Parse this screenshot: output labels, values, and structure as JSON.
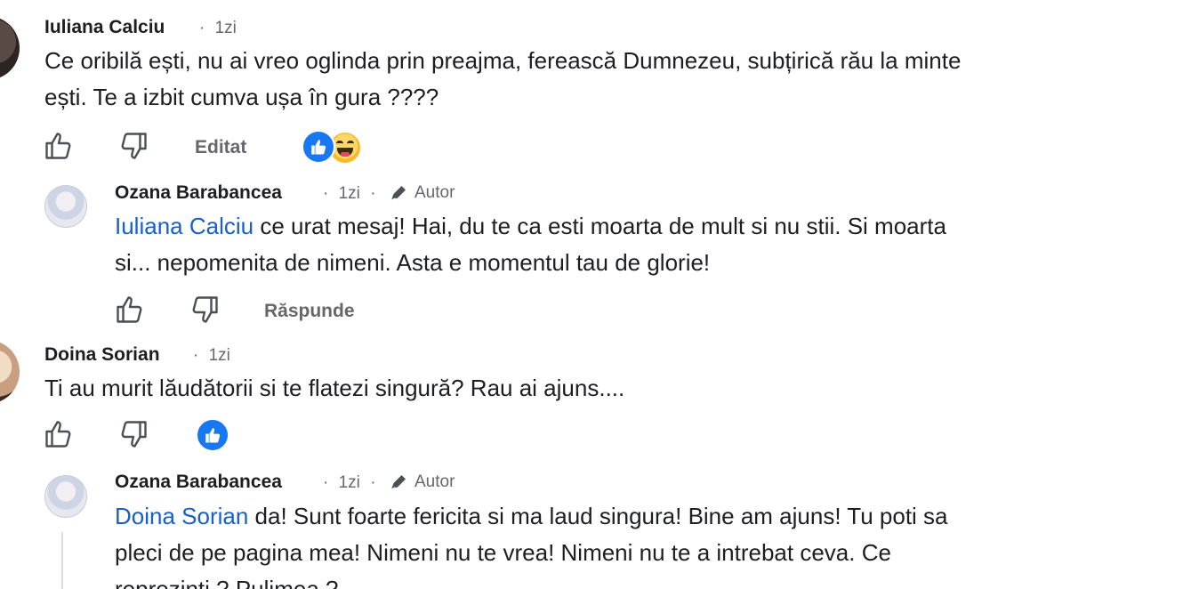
{
  "comments": [
    {
      "author": "Iuliana Calciu",
      "time": "1zi",
      "text": "Ce oribilă ești, nu ai vreo oglinda prin preajma, ferească Dumnezeu, subțirică rău la minte ești. Te a izbit cumva ușa în gura ????",
      "text_line1": "Ce oribilă ești, nu ai vreo oglinda prin preajma, ferească Dumnezeu, subțirică rău la minte",
      "text_line2": "ești. Te a izbit cumva ușa în gura ????",
      "edited_label": "Editat",
      "reactions": [
        "like-icon",
        "haha-icon"
      ],
      "reply": {
        "author": "Ozana Barabancea",
        "time": "1zi",
        "badge": "Autor",
        "mention": "Iuliana Calciu",
        "text_line1": " ce urat mesaj! Hai, du te ca esti moarta de mult si nu stii. Si moarta",
        "text_line2": "si... nepomenita de nimeni. Asta e momentul tau de glorie!",
        "reply_label": "Răspunde"
      }
    },
    {
      "author": "Doina Sorian",
      "time": "1zi",
      "text": "Ti au murit lăudătorii si te flatezi singură? Rau ai ajuns....",
      "reactions": [
        "like-icon"
      ],
      "reply": {
        "author": "Ozana Barabancea",
        "time": "1zi",
        "badge": "Autor",
        "mention": "Doina Sorian",
        "text_line1": " da! Sunt foarte fericita si ma laud singura! Bine am ajuns! Tu poti sa",
        "text_line2": "pleci de pe pagina mea! Nimeni nu te vrea! Nimeni nu te a intrebat ceva. Ce",
        "text_line3": "reprezinti ? Pulimea ?"
      }
    }
  ],
  "separator": "·",
  "colors": {
    "mention": "#1660c7",
    "meta": "#65676b",
    "like_blue": "#1877f2",
    "haha_yellow": "#f7b928"
  }
}
